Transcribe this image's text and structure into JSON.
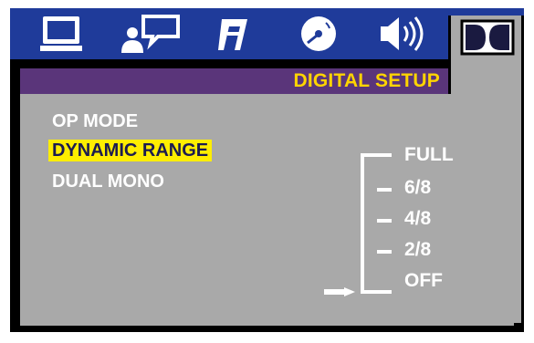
{
  "tabs": [
    {
      "icon": "monitor-icon",
      "label": "general"
    },
    {
      "icon": "speech-person-icon",
      "label": "language"
    },
    {
      "icon": "music-note-icon",
      "label": "audio"
    },
    {
      "icon": "disc-icon",
      "label": "video"
    },
    {
      "icon": "speaker-icon",
      "label": "speaker"
    },
    {
      "icon": "dolby-digital-icon",
      "label": "digital"
    }
  ],
  "menu": {
    "title": "DIGITAL SETUP",
    "items": [
      "OP MODE",
      "DYNAMIC RANGE",
      "DUAL MONO"
    ],
    "selected_index": 1
  },
  "dynamic_range": {
    "options": [
      "FULL",
      "6/8",
      "4/8",
      "2/8",
      "OFF"
    ],
    "current": "OFF"
  },
  "colors": {
    "frame": "#000000",
    "topbar": "#1f3b9a",
    "titlebar": "#5a357a",
    "panel": "#a9a9a9",
    "title_text": "#ffd400",
    "highlight": "#ffee00"
  }
}
